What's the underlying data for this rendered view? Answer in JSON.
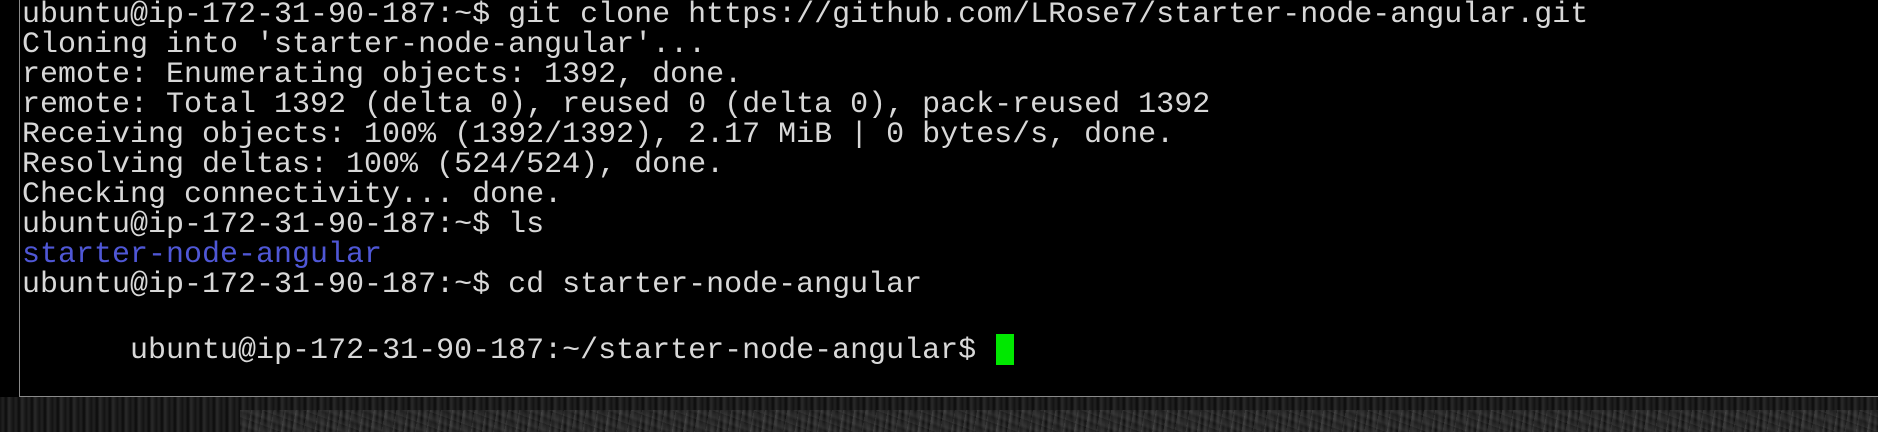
{
  "terminal": {
    "lines": [
      "ubuntu@ip-172-31-90-187:~$ git clone https://github.com/LRose7/starter-node-angular.git",
      "Cloning into 'starter-node-angular'...",
      "remote: Enumerating objects: 1392, done.",
      "remote: Total 1392 (delta 0), reused 0 (delta 0), pack-reused 1392",
      "Receiving objects: 100% (1392/1392), 2.17 MiB | 0 bytes/s, done.",
      "Resolving deltas: 100% (524/524), done.",
      "Checking connectivity... done.",
      "ubuntu@ip-172-31-90-187:~$ ls",
      "starter-node-angular",
      "ubuntu@ip-172-31-90-187:~$ cd starter-node-angular",
      "ubuntu@ip-172-31-90-187:~/starter-node-angular$"
    ],
    "colors": {
      "background": "#000000",
      "text": "#d8d8d8",
      "directory": "#4f57d6",
      "cursor": "#00e800"
    }
  }
}
